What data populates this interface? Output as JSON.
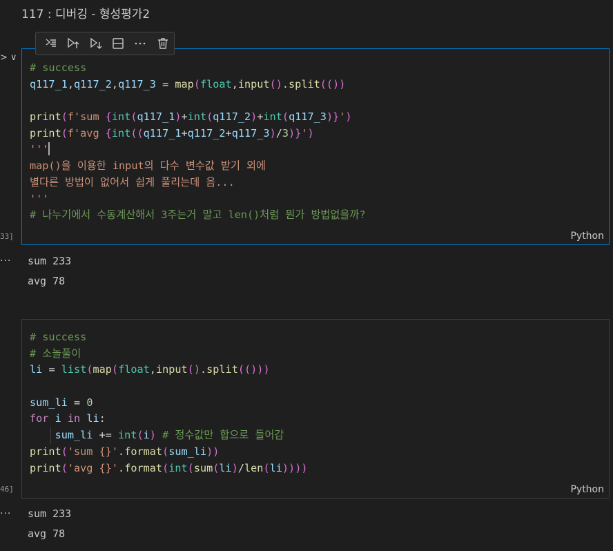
{
  "heading": "117 : 디버깅 - 형성평가2",
  "toolbar": {
    "icons": [
      "run-by-line-icon",
      "execute-above-icon",
      "execute-below-icon",
      "split-cell-icon",
      "more-actions-icon",
      "delete-icon"
    ]
  },
  "cells": [
    {
      "exec_label": "33]",
      "language": "Python",
      "lines": [
        [
          [
            "cmt",
            "# success"
          ]
        ],
        [
          [
            "var",
            "q117_1"
          ],
          [
            "p",
            ","
          ],
          [
            "var",
            "q117_2"
          ],
          [
            "p",
            ","
          ],
          [
            "var",
            "q117_3"
          ],
          [
            "op",
            " = "
          ],
          [
            "fn",
            "map"
          ],
          [
            "br",
            "("
          ],
          [
            "cls",
            "float"
          ],
          [
            "p",
            ","
          ],
          [
            "fn",
            "input"
          ],
          [
            "br",
            "("
          ],
          [
            "br",
            ")"
          ],
          [
            "p",
            "."
          ],
          [
            "fn",
            "split"
          ],
          [
            "br",
            "(("
          ],
          [
            "br",
            ")"
          ],
          [
            "br",
            ")"
          ]
        ],
        [
          [
            "p",
            ""
          ]
        ],
        [
          [
            "fn",
            "print"
          ],
          [
            "br",
            "("
          ],
          [
            "str",
            "f'sum "
          ],
          [
            "br",
            "{"
          ],
          [
            "cls",
            "int"
          ],
          [
            "br",
            "("
          ],
          [
            "var",
            "q117_1"
          ],
          [
            "br",
            ")"
          ],
          [
            "op",
            "+"
          ],
          [
            "cls",
            "int"
          ],
          [
            "br",
            "("
          ],
          [
            "var",
            "q117_2"
          ],
          [
            "br",
            ")"
          ],
          [
            "op",
            "+"
          ],
          [
            "cls",
            "int"
          ],
          [
            "br",
            "("
          ],
          [
            "var",
            "q117_3"
          ],
          [
            "br",
            ")"
          ],
          [
            "br",
            "}"
          ],
          [
            "str",
            "'"
          ],
          [
            "br",
            ")"
          ]
        ],
        [
          [
            "fn",
            "print"
          ],
          [
            "br",
            "("
          ],
          [
            "str",
            "f'avg "
          ],
          [
            "br",
            "{"
          ],
          [
            "cls",
            "int"
          ],
          [
            "br",
            "(("
          ],
          [
            "var",
            "q117_1"
          ],
          [
            "op",
            "+"
          ],
          [
            "var",
            "q117_2"
          ],
          [
            "op",
            "+"
          ],
          [
            "var",
            "q117_3"
          ],
          [
            "br",
            ")"
          ],
          [
            "op",
            "/"
          ],
          [
            "num",
            "3"
          ],
          [
            "br",
            ")"
          ],
          [
            "br",
            "}"
          ],
          [
            "str",
            "'"
          ],
          [
            "br",
            ")"
          ]
        ],
        [
          [
            "str",
            "'''"
          ],
          [
            "cursor",
            ""
          ]
        ],
        [
          [
            "str",
            "map()을 이용한 input의 다수 변수값 받기 외에"
          ]
        ],
        [
          [
            "str",
            "별다른 방법이 없어서 쉽게 풀리는데 음..."
          ]
        ],
        [
          [
            "str",
            "'''"
          ]
        ],
        [
          [
            "cmt",
            "# 나누기에서 수동계산해서 3주는거 말고 len()처럼 뭔가 방법없을까?"
          ]
        ]
      ],
      "output": [
        "sum 233",
        "avg 78"
      ]
    },
    {
      "exec_label": "46]",
      "language": "Python",
      "lines": [
        [
          [
            "cmt",
            "# success"
          ]
        ],
        [
          [
            "cmt",
            "# 소놀풀이"
          ]
        ],
        [
          [
            "var",
            "li"
          ],
          [
            "op",
            " = "
          ],
          [
            "cls",
            "list"
          ],
          [
            "br",
            "("
          ],
          [
            "fn",
            "map"
          ],
          [
            "br",
            "("
          ],
          [
            "cls",
            "float"
          ],
          [
            "p",
            ","
          ],
          [
            "fn",
            "input"
          ],
          [
            "br",
            "("
          ],
          [
            "br",
            ")"
          ],
          [
            "p",
            "."
          ],
          [
            "fn",
            "split"
          ],
          [
            "br",
            "(("
          ],
          [
            "br",
            ")"
          ],
          [
            "br",
            "))"
          ]
        ],
        [
          [
            "p",
            ""
          ]
        ],
        [
          [
            "var",
            "sum_li"
          ],
          [
            "op",
            " = "
          ],
          [
            "num",
            "0"
          ]
        ],
        [
          [
            "kw",
            "for"
          ],
          [
            "p",
            " "
          ],
          [
            "var",
            "i"
          ],
          [
            "p",
            " "
          ],
          [
            "kw",
            "in"
          ],
          [
            "p",
            " "
          ],
          [
            "var",
            "li"
          ],
          [
            "p",
            ":"
          ]
        ],
        [
          [
            "p",
            "    "
          ],
          [
            "var",
            "sum_li"
          ],
          [
            "op",
            " += "
          ],
          [
            "cls",
            "int"
          ],
          [
            "br",
            "("
          ],
          [
            "var",
            "i"
          ],
          [
            "br",
            ")"
          ],
          [
            "p",
            " "
          ],
          [
            "cmt",
            "# 정수값만 합으로 들어감"
          ]
        ],
        [
          [
            "fn",
            "print"
          ],
          [
            "br",
            "("
          ],
          [
            "str",
            "'sum {}'"
          ],
          [
            "p",
            "."
          ],
          [
            "fn",
            "format"
          ],
          [
            "br",
            "("
          ],
          [
            "var",
            "sum_li"
          ],
          [
            "br",
            "))"
          ]
        ],
        [
          [
            "fn",
            "print"
          ],
          [
            "br",
            "("
          ],
          [
            "str",
            "'avg {}'"
          ],
          [
            "p",
            "."
          ],
          [
            "fn",
            "format"
          ],
          [
            "br",
            "("
          ],
          [
            "cls",
            "int"
          ],
          [
            "br",
            "("
          ],
          [
            "fn",
            "sum"
          ],
          [
            "br",
            "("
          ],
          [
            "var",
            "li"
          ],
          [
            "br",
            ")"
          ],
          [
            "op",
            "/"
          ],
          [
            "fn",
            "len"
          ],
          [
            "br",
            "("
          ],
          [
            "var",
            "li"
          ],
          [
            "br",
            "))))"
          ]
        ]
      ],
      "output": [
        "sum 233",
        "avg 78"
      ]
    }
  ]
}
